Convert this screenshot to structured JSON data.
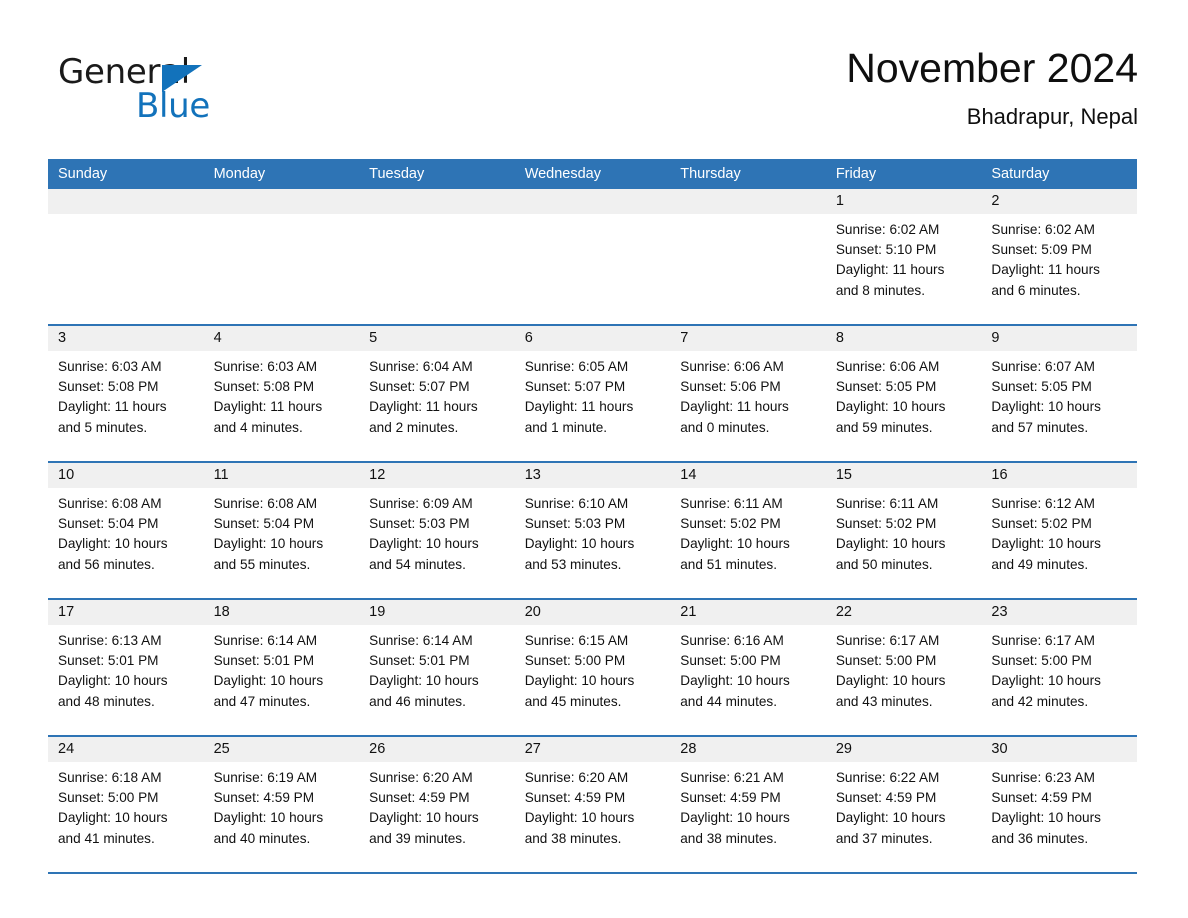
{
  "logo": {
    "word_one": "General",
    "word_two": "Blue",
    "triangle_color": "#1272bb",
    "accent_color": "#2e74b5"
  },
  "header": {
    "title": "November 2024",
    "subtitle": "Bhadrapur, Nepal"
  },
  "weekday_headers": [
    "Sunday",
    "Monday",
    "Tuesday",
    "Wednesday",
    "Thursday",
    "Friday",
    "Saturday"
  ],
  "labels": {
    "sunrise": "Sunrise:",
    "sunset": "Sunset:",
    "daylight": "Daylight:"
  },
  "weeks": [
    [
      {
        "day": "",
        "sunrise": "",
        "sunset": "",
        "daylight_line1": "",
        "daylight_line2": "",
        "empty": true
      },
      {
        "day": "",
        "sunrise": "",
        "sunset": "",
        "daylight_line1": "",
        "daylight_line2": "",
        "empty": true
      },
      {
        "day": "",
        "sunrise": "",
        "sunset": "",
        "daylight_line1": "",
        "daylight_line2": "",
        "empty": true
      },
      {
        "day": "",
        "sunrise": "",
        "sunset": "",
        "daylight_line1": "",
        "daylight_line2": "",
        "empty": true
      },
      {
        "day": "",
        "sunrise": "",
        "sunset": "",
        "daylight_line1": "",
        "daylight_line2": "",
        "empty": true
      },
      {
        "day": "1",
        "sunrise": "Sunrise: 6:02 AM",
        "sunset": "Sunset: 5:10 PM",
        "daylight_line1": "Daylight: 11 hours",
        "daylight_line2": "and 8 minutes."
      },
      {
        "day": "2",
        "sunrise": "Sunrise: 6:02 AM",
        "sunset": "Sunset: 5:09 PM",
        "daylight_line1": "Daylight: 11 hours",
        "daylight_line2": "and 6 minutes."
      }
    ],
    [
      {
        "day": "3",
        "sunrise": "Sunrise: 6:03 AM",
        "sunset": "Sunset: 5:08 PM",
        "daylight_line1": "Daylight: 11 hours",
        "daylight_line2": "and 5 minutes."
      },
      {
        "day": "4",
        "sunrise": "Sunrise: 6:03 AM",
        "sunset": "Sunset: 5:08 PM",
        "daylight_line1": "Daylight: 11 hours",
        "daylight_line2": "and 4 minutes."
      },
      {
        "day": "5",
        "sunrise": "Sunrise: 6:04 AM",
        "sunset": "Sunset: 5:07 PM",
        "daylight_line1": "Daylight: 11 hours",
        "daylight_line2": "and 2 minutes."
      },
      {
        "day": "6",
        "sunrise": "Sunrise: 6:05 AM",
        "sunset": "Sunset: 5:07 PM",
        "daylight_line1": "Daylight: 11 hours",
        "daylight_line2": "and 1 minute."
      },
      {
        "day": "7",
        "sunrise": "Sunrise: 6:06 AM",
        "sunset": "Sunset: 5:06 PM",
        "daylight_line1": "Daylight: 11 hours",
        "daylight_line2": "and 0 minutes."
      },
      {
        "day": "8",
        "sunrise": "Sunrise: 6:06 AM",
        "sunset": "Sunset: 5:05 PM",
        "daylight_line1": "Daylight: 10 hours",
        "daylight_line2": "and 59 minutes."
      },
      {
        "day": "9",
        "sunrise": "Sunrise: 6:07 AM",
        "sunset": "Sunset: 5:05 PM",
        "daylight_line1": "Daylight: 10 hours",
        "daylight_line2": "and 57 minutes."
      }
    ],
    [
      {
        "day": "10",
        "sunrise": "Sunrise: 6:08 AM",
        "sunset": "Sunset: 5:04 PM",
        "daylight_line1": "Daylight: 10 hours",
        "daylight_line2": "and 56 minutes."
      },
      {
        "day": "11",
        "sunrise": "Sunrise: 6:08 AM",
        "sunset": "Sunset: 5:04 PM",
        "daylight_line1": "Daylight: 10 hours",
        "daylight_line2": "and 55 minutes."
      },
      {
        "day": "12",
        "sunrise": "Sunrise: 6:09 AM",
        "sunset": "Sunset: 5:03 PM",
        "daylight_line1": "Daylight: 10 hours",
        "daylight_line2": "and 54 minutes."
      },
      {
        "day": "13",
        "sunrise": "Sunrise: 6:10 AM",
        "sunset": "Sunset: 5:03 PM",
        "daylight_line1": "Daylight: 10 hours",
        "daylight_line2": "and 53 minutes."
      },
      {
        "day": "14",
        "sunrise": "Sunrise: 6:11 AM",
        "sunset": "Sunset: 5:02 PM",
        "daylight_line1": "Daylight: 10 hours",
        "daylight_line2": "and 51 minutes."
      },
      {
        "day": "15",
        "sunrise": "Sunrise: 6:11 AM",
        "sunset": "Sunset: 5:02 PM",
        "daylight_line1": "Daylight: 10 hours",
        "daylight_line2": "and 50 minutes."
      },
      {
        "day": "16",
        "sunrise": "Sunrise: 6:12 AM",
        "sunset": "Sunset: 5:02 PM",
        "daylight_line1": "Daylight: 10 hours",
        "daylight_line2": "and 49 minutes."
      }
    ],
    [
      {
        "day": "17",
        "sunrise": "Sunrise: 6:13 AM",
        "sunset": "Sunset: 5:01 PM",
        "daylight_line1": "Daylight: 10 hours",
        "daylight_line2": "and 48 minutes."
      },
      {
        "day": "18",
        "sunrise": "Sunrise: 6:14 AM",
        "sunset": "Sunset: 5:01 PM",
        "daylight_line1": "Daylight: 10 hours",
        "daylight_line2": "and 47 minutes."
      },
      {
        "day": "19",
        "sunrise": "Sunrise: 6:14 AM",
        "sunset": "Sunset: 5:01 PM",
        "daylight_line1": "Daylight: 10 hours",
        "daylight_line2": "and 46 minutes."
      },
      {
        "day": "20",
        "sunrise": "Sunrise: 6:15 AM",
        "sunset": "Sunset: 5:00 PM",
        "daylight_line1": "Daylight: 10 hours",
        "daylight_line2": "and 45 minutes."
      },
      {
        "day": "21",
        "sunrise": "Sunrise: 6:16 AM",
        "sunset": "Sunset: 5:00 PM",
        "daylight_line1": "Daylight: 10 hours",
        "daylight_line2": "and 44 minutes."
      },
      {
        "day": "22",
        "sunrise": "Sunrise: 6:17 AM",
        "sunset": "Sunset: 5:00 PM",
        "daylight_line1": "Daylight: 10 hours",
        "daylight_line2": "and 43 minutes."
      },
      {
        "day": "23",
        "sunrise": "Sunrise: 6:17 AM",
        "sunset": "Sunset: 5:00 PM",
        "daylight_line1": "Daylight: 10 hours",
        "daylight_line2": "and 42 minutes."
      }
    ],
    [
      {
        "day": "24",
        "sunrise": "Sunrise: 6:18 AM",
        "sunset": "Sunset: 5:00 PM",
        "daylight_line1": "Daylight: 10 hours",
        "daylight_line2": "and 41 minutes."
      },
      {
        "day": "25",
        "sunrise": "Sunrise: 6:19 AM",
        "sunset": "Sunset: 4:59 PM",
        "daylight_line1": "Daylight: 10 hours",
        "daylight_line2": "and 40 minutes."
      },
      {
        "day": "26",
        "sunrise": "Sunrise: 6:20 AM",
        "sunset": "Sunset: 4:59 PM",
        "daylight_line1": "Daylight: 10 hours",
        "daylight_line2": "and 39 minutes."
      },
      {
        "day": "27",
        "sunrise": "Sunrise: 6:20 AM",
        "sunset": "Sunset: 4:59 PM",
        "daylight_line1": "Daylight: 10 hours",
        "daylight_line2": "and 38 minutes."
      },
      {
        "day": "28",
        "sunrise": "Sunrise: 6:21 AM",
        "sunset": "Sunset: 4:59 PM",
        "daylight_line1": "Daylight: 10 hours",
        "daylight_line2": "and 38 minutes."
      },
      {
        "day": "29",
        "sunrise": "Sunrise: 6:22 AM",
        "sunset": "Sunset: 4:59 PM",
        "daylight_line1": "Daylight: 10 hours",
        "daylight_line2": "and 37 minutes."
      },
      {
        "day": "30",
        "sunrise": "Sunrise: 6:23 AM",
        "sunset": "Sunset: 4:59 PM",
        "daylight_line1": "Daylight: 10 hours",
        "daylight_line2": "and 36 minutes."
      }
    ]
  ]
}
